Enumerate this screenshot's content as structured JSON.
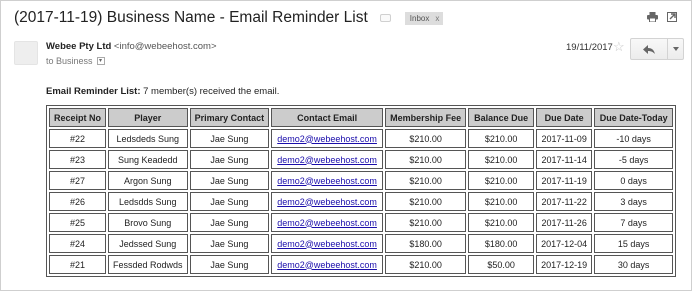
{
  "subject": "(2017-11-19) Business Name - Email Reminder List",
  "inbox_label": "Inbox",
  "inbox_remove": "x",
  "icons": [
    "label-toggle-icon",
    "print-icon",
    "open-new-window-icon",
    "star-icon",
    "reply-icon",
    "more-options-icon"
  ],
  "sender": {
    "name": "Webee Pty Ltd",
    "email": "<info@webeehost.com>",
    "to": "to Business"
  },
  "date": "19/11/2017",
  "intro": {
    "label": "Email Reminder List:",
    "text": " 7 member(s) received the email."
  },
  "table": {
    "headers": [
      "Receipt No",
      "Player",
      "Primary Contact",
      "Contact Email",
      "Membership Fee",
      "Balance Due",
      "Due Date",
      "Due Date-Today"
    ],
    "rows": [
      [
        "#22",
        "Ledsdeds Sung",
        "Jae Sung",
        "demo2@webeehost.com",
        "$210.00",
        "$210.00",
        "2017-11-09",
        "-10 days"
      ],
      [
        "#23",
        "Sung Keadedd",
        "Jae Sung",
        "demo2@webeehost.com",
        "$210.00",
        "$210.00",
        "2017-11-14",
        "-5 days"
      ],
      [
        "#27",
        "Argon Sung",
        "Jae Sung",
        "demo2@webeehost.com",
        "$210.00",
        "$210.00",
        "2017-11-19",
        "0 days"
      ],
      [
        "#26",
        "Ledsdds Sung",
        "Jae Sung",
        "demo2@webeehost.com",
        "$210.00",
        "$210.00",
        "2017-11-22",
        "3 days"
      ],
      [
        "#25",
        "Brovo Sung",
        "Jae Sung",
        "demo2@webeehost.com",
        "$210.00",
        "$210.00",
        "2017-11-26",
        "7 days"
      ],
      [
        "#24",
        "Jedssed Sung",
        "Jae Sung",
        "demo2@webeehost.com",
        "$180.00",
        "$180.00",
        "2017-12-04",
        "15 days"
      ],
      [
        "#21",
        "Fessded Rodwds",
        "Jae Sung",
        "demo2@webeehost.com",
        "$210.00",
        "$50.00",
        "2017-12-19",
        "30 days"
      ]
    ]
  }
}
